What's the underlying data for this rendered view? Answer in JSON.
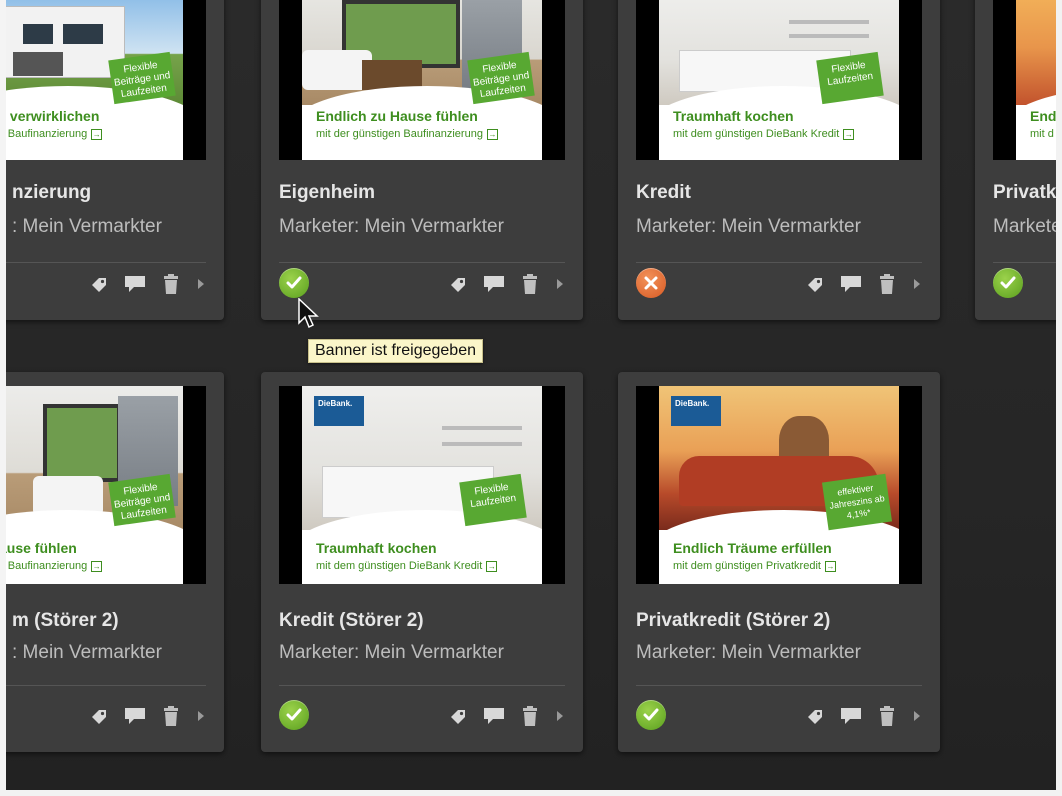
{
  "cards": [
    {
      "title": "nzierung",
      "marketer": ": Mein Vermarkter",
      "headline": "enheim verwirklichen",
      "subline": "günstigen Baufinanzierung",
      "badge": "Flexible Beiträge und Laufzeiten",
      "status": "none"
    },
    {
      "title": "Eigenheim",
      "marketer": "Marketer: Mein Vermarkter",
      "headline": "Endlich zu Hause fühlen",
      "subline": "mit der günstigen Baufinanzierung",
      "badge": "Flexible Beiträge und Laufzeiten",
      "status": "approved"
    },
    {
      "title": "Kredit",
      "marketer": "Marketer: Mein Vermarkter",
      "headline": "Traumhaft kochen",
      "subline": "mit dem günstigen DieBank Kredit",
      "badge": "Flexible Laufzeiten",
      "status": "rejected"
    },
    {
      "title": "Privatk",
      "marketer": "Markete",
      "headline": "Endl",
      "subline": "mit d",
      "badge": "",
      "status": "approved"
    },
    {
      "title": "m (Störer 2)",
      "marketer": ": Mein Vermarkter",
      "headline": "n zu Hause fühlen",
      "subline": "günstigen Baufinanzierung",
      "badge": "Flexible Beiträge und Laufzeiten",
      "status": "none"
    },
    {
      "title": "Kredit (Störer 2)",
      "marketer": "Marketer: Mein Vermarkter",
      "headline": "Traumhaft kochen",
      "subline": "mit dem günstigen DieBank Kredit",
      "badge": "Flexible Laufzeiten",
      "logo": "DieBank.",
      "status": "approved"
    },
    {
      "title": "Privatkredit (Störer 2)",
      "marketer": "Marketer: Mein Vermarkter",
      "headline": "Endlich Träume erfüllen",
      "subline": "mit dem günstigen Privatkredit",
      "badge": "effektiver Jahreszins ab 4,1%*",
      "logo": "DieBank.",
      "status": "approved"
    }
  ],
  "tooltip": "Banner ist freigegeben",
  "colors": {
    "background": "#262626",
    "card": "#3d3d3d",
    "approved": "#6cae2c",
    "rejected": "#e2672e",
    "ad_green": "#3e8e1f",
    "badge_green": "#58a832",
    "tooltip_bg": "#fbf6c9"
  },
  "icons": {
    "tag": "tag-icon",
    "comment": "comment-icon",
    "delete": "trash-icon",
    "more": "chevron-right-icon",
    "approved": "check-icon",
    "rejected": "close-icon"
  }
}
